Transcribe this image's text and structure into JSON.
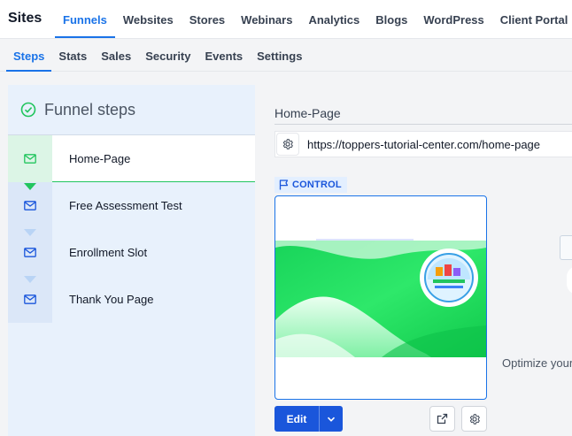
{
  "app": {
    "title": "Sites"
  },
  "top_nav": [
    {
      "label": "Funnels",
      "active": true
    },
    {
      "label": "Websites",
      "active": false
    },
    {
      "label": "Stores",
      "active": false
    },
    {
      "label": "Webinars",
      "active": false
    },
    {
      "label": "Analytics",
      "active": false
    },
    {
      "label": "Blogs",
      "active": false
    },
    {
      "label": "WordPress",
      "active": false
    },
    {
      "label": "Client Portal",
      "active": false
    }
  ],
  "sub_tabs": [
    {
      "label": "Steps",
      "active": true
    },
    {
      "label": "Stats",
      "active": false
    },
    {
      "label": "Sales",
      "active": false
    },
    {
      "label": "Security",
      "active": false
    },
    {
      "label": "Events",
      "active": false
    },
    {
      "label": "Settings",
      "active": false
    }
  ],
  "funnel_steps": {
    "title": "Funnel steps",
    "steps": [
      {
        "label": "Home-Page",
        "active": true
      },
      {
        "label": "Free Assessment Test",
        "active": false
      },
      {
        "label": "Enrollment Slot",
        "active": false
      },
      {
        "label": "Thank You Page",
        "active": false
      }
    ]
  },
  "page": {
    "name": "Home-Page",
    "url": "https://toppers-tutorial-center.com/home-page",
    "variant_badge": "CONTROL",
    "edit_label": "Edit",
    "optimize_text": "Optimize your"
  },
  "colors": {
    "accent": "#1a73e8",
    "primary_button": "#1a56db",
    "success": "#22c55e",
    "panel_bg": "#e8f1fc"
  },
  "icons": {
    "steps": "mail-icon",
    "header": "check-circle-icon",
    "url_settings": "gear-icon",
    "badge": "flag-icon",
    "open": "external-link-icon",
    "settings": "gear-icon"
  }
}
